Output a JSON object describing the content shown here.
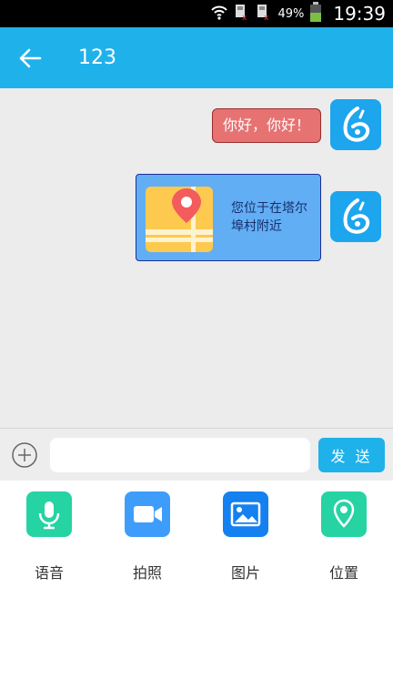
{
  "status_bar": {
    "battery_percent": "49%",
    "time": "19:39",
    "icons": [
      "wifi-icon",
      "sim1-no-signal-icon",
      "sim2-no-signal-icon",
      "battery-icon"
    ]
  },
  "header": {
    "back_icon": "arrow-left-icon",
    "title": "123"
  },
  "messages": [
    {
      "type": "text",
      "sender": "me",
      "text": "你好，你好！",
      "bubble_color": "#e77272"
    },
    {
      "type": "location",
      "sender": "me",
      "text": "您位于在塔尔埠村附近",
      "bubble_color": "#62aef5",
      "icon": "map-pin-icon"
    }
  ],
  "input_bar": {
    "plus_icon": "plus-circle-icon",
    "value": "",
    "send_label": "发 送"
  },
  "tools": [
    {
      "label": "语音",
      "icon": "microphone-icon",
      "color": "#25d3a3"
    },
    {
      "label": "拍照",
      "icon": "video-camera-icon",
      "color": "#3e9dfb"
    },
    {
      "label": "图片",
      "icon": "image-icon",
      "color": "#1580f0"
    },
    {
      "label": "位置",
      "icon": "location-pin-icon",
      "color": "#25d3a3"
    }
  ],
  "colors": {
    "accent": "#1fb1ea",
    "status_bar": "#000000",
    "chat_background": "#ececec"
  }
}
